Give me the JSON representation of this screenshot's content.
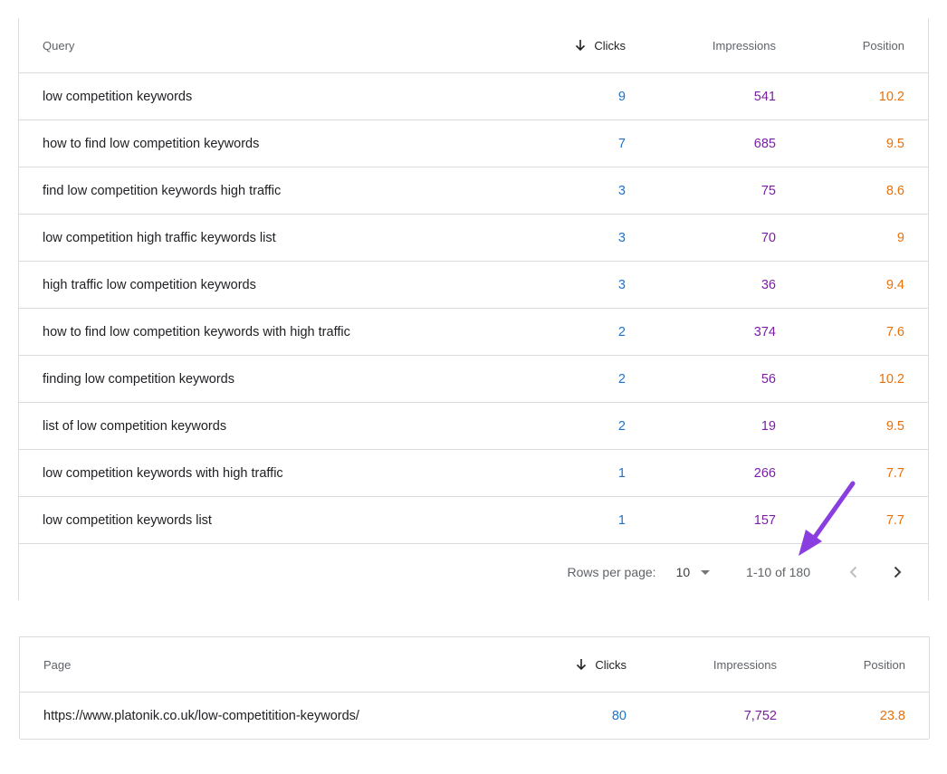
{
  "queries_table": {
    "headers": {
      "query": "Query",
      "clicks": "Clicks",
      "impressions": "Impressions",
      "position": "Position"
    },
    "rows": [
      {
        "query": "low competition keywords",
        "clicks": "9",
        "impressions": "541",
        "position": "10.2"
      },
      {
        "query": "how to find low competition keywords",
        "clicks": "7",
        "impressions": "685",
        "position": "9.5"
      },
      {
        "query": "find low competition keywords high traffic",
        "clicks": "3",
        "impressions": "75",
        "position": "8.6"
      },
      {
        "query": "low competition high traffic keywords list",
        "clicks": "3",
        "impressions": "70",
        "position": "9"
      },
      {
        "query": "high traffic low competition keywords",
        "clicks": "3",
        "impressions": "36",
        "position": "9.4"
      },
      {
        "query": "how to find low competition keywords with high traffic",
        "clicks": "2",
        "impressions": "374",
        "position": "7.6"
      },
      {
        "query": "finding low competition keywords",
        "clicks": "2",
        "impressions": "56",
        "position": "10.2"
      },
      {
        "query": "list of low competition keywords",
        "clicks": "2",
        "impressions": "19",
        "position": "9.5"
      },
      {
        "query": "low competition keywords with high traffic",
        "clicks": "1",
        "impressions": "266",
        "position": "7.7"
      },
      {
        "query": "low competition keywords list",
        "clicks": "1",
        "impressions": "157",
        "position": "7.7"
      }
    ],
    "pagination": {
      "rows_per_page_label": "Rows per page:",
      "rows_per_page_value": "10",
      "range": "1-10 of 180"
    }
  },
  "pages_table": {
    "headers": {
      "page": "Page",
      "clicks": "Clicks",
      "impressions": "Impressions",
      "position": "Position"
    },
    "rows": [
      {
        "page": "https://www.platonik.co.uk/low-competitition-keywords/",
        "clicks": "80",
        "impressions": "7,752",
        "position": "23.8"
      }
    ]
  },
  "colors": {
    "clicks": "#1e73c8",
    "impressions": "#7b1fa2",
    "position": "#e8710a",
    "annotation_arrow": "#8a3ee0",
    "border": "#dadce0"
  },
  "icons": {
    "sort": "arrow-down-icon",
    "dropdown": "caret-down-icon",
    "prev": "chevron-left-icon",
    "next": "chevron-right-icon"
  }
}
